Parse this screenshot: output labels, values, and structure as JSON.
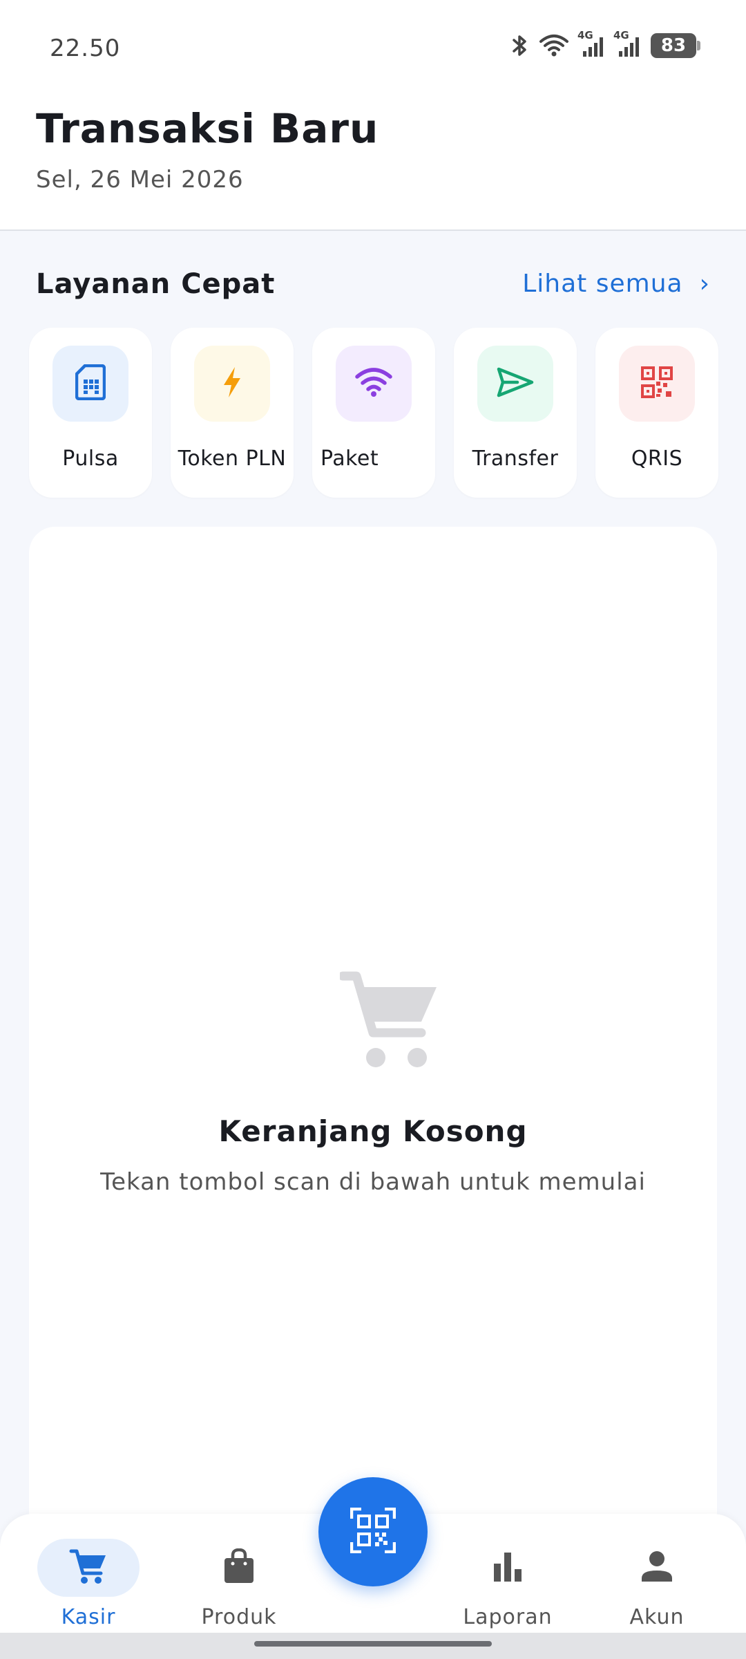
{
  "status_bar": {
    "time": "22.50",
    "network_1": "4G",
    "network_2": "4G",
    "battery": "83"
  },
  "header": {
    "title": "Transaksi Baru",
    "date": "Sel, 26 Mei 2026"
  },
  "quick_services": {
    "title": "Layanan Cepat",
    "see_all": "Lihat semua",
    "see_all_chevron": "›",
    "items": [
      {
        "label": "Pulsa",
        "icon": "sim-card-icon",
        "color": "#1f6fd6",
        "bg": "#e8f1fd"
      },
      {
        "label": "Token PLN",
        "icon": "lightning-icon",
        "color": "#f59e0b",
        "bg": "#fef9e7"
      },
      {
        "label": "Paket",
        "icon": "wifi-icon",
        "color": "#8b3fe0",
        "bg": "#f3ecfe"
      },
      {
        "label": "Transfer",
        "icon": "send-icon",
        "color": "#16a673",
        "bg": "#e8faf2"
      },
      {
        "label": "QRIS",
        "icon": "qr-code-icon",
        "color": "#e04545",
        "bg": "#fdeeee"
      }
    ]
  },
  "cart": {
    "title": "Keranjang Kosong",
    "subtitle": "Tekan tombol scan di bawah untuk memulai",
    "icon": "shopping-cart-icon"
  },
  "bottom_nav": {
    "items": [
      {
        "label": "Kasir",
        "icon": "cart-icon",
        "active": true
      },
      {
        "label": "Produk",
        "icon": "shopping-bag-icon",
        "active": false
      },
      {
        "label": "Laporan",
        "icon": "bar-chart-icon",
        "active": false
      },
      {
        "label": "Akun",
        "icon": "person-icon",
        "active": false
      }
    ],
    "scan_icon": "qr-scan-icon"
  },
  "colors": {
    "accent": "#1f74e8",
    "link": "#1f6fd6",
    "background": "#f5f7fc"
  }
}
